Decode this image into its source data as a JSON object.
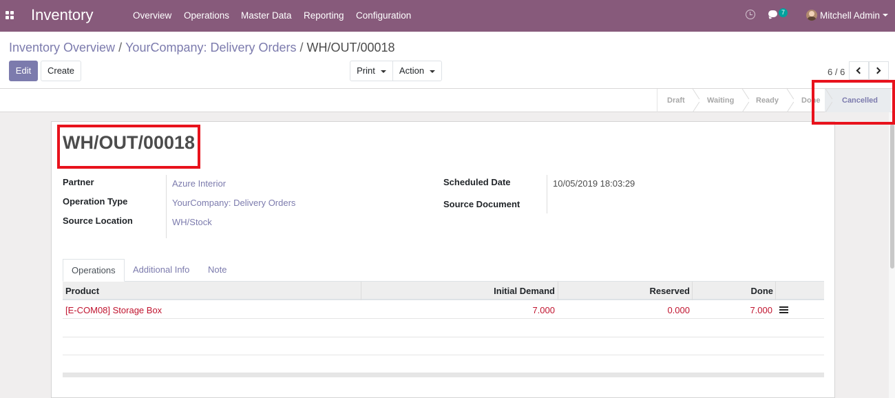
{
  "navbar": {
    "app_name": "Inventory",
    "menu": [
      "Overview",
      "Operations",
      "Master Data",
      "Reporting",
      "Configuration"
    ],
    "message_count": "7",
    "user_name": "Mitchell Admin"
  },
  "breadcrumb": {
    "items": [
      "Inventory Overview",
      "YourCompany: Delivery Orders"
    ],
    "current": "WH/OUT/00018",
    "separator": "/"
  },
  "buttons": {
    "edit": "Edit",
    "create": "Create",
    "print": "Print",
    "action": "Action"
  },
  "pager": {
    "value": "6 / 6"
  },
  "statusbar": {
    "steps": [
      "Draft",
      "Waiting",
      "Ready",
      "Done",
      "Cancelled"
    ],
    "active": "Cancelled"
  },
  "record": {
    "title": "WH/OUT/00018",
    "fields": {
      "partner": {
        "label": "Partner",
        "value": "Azure Interior"
      },
      "operation_type": {
        "label": "Operation Type",
        "value": "YourCompany: Delivery Orders"
      },
      "source_location": {
        "label": "Source Location",
        "value": "WH/Stock"
      },
      "scheduled_date": {
        "label": "Scheduled Date",
        "value": "10/05/2019 18:03:29"
      },
      "source_document": {
        "label": "Source Document",
        "value": ""
      }
    }
  },
  "tabs": [
    "Operations",
    "Additional Info",
    "Note"
  ],
  "operations_table": {
    "columns": [
      "Product",
      "Initial Demand",
      "Reserved",
      "Done"
    ],
    "rows": [
      {
        "product": "[E-COM08] Storage Box",
        "initial_demand": "7.000",
        "reserved": "0.000",
        "done": "7.000"
      }
    ]
  },
  "colors": {
    "brand": "#875a7b",
    "link": "#7c7bad",
    "row_text": "#c0132e",
    "annotation": "#e8121c"
  }
}
